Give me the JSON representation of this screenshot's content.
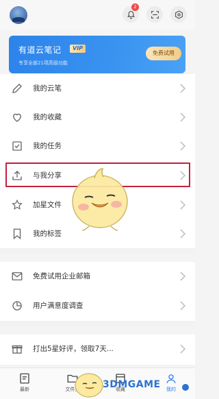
{
  "header": {
    "notification_count": "2",
    "icons": [
      "bell-icon",
      "scan-icon",
      "settings-icon"
    ]
  },
  "vip": {
    "title": "有道云笔记",
    "tag": "VIP",
    "subtitle": "专享全部21项高级功能",
    "button": "免费试用"
  },
  "menu": {
    "group1": [
      {
        "label": "我的云笔",
        "icon": "pencil-icon"
      },
      {
        "label": "我的收藏",
        "icon": "heart-icon"
      },
      {
        "label": "我的任务",
        "icon": "checkbox-icon"
      },
      {
        "label": "与我分享",
        "icon": "share-upload-icon"
      },
      {
        "label": "加星文件",
        "icon": "star-icon"
      },
      {
        "label": "我的标签",
        "icon": "bookmark-icon"
      }
    ],
    "group2": [
      {
        "label": "免费试用企业邮箱",
        "icon": "mail-icon"
      },
      {
        "label": "用户满意度调查",
        "icon": "pie-chart-icon"
      }
    ],
    "group3": [
      {
        "label": "打出5星好评，领取7天...",
        "icon": "gift-icon"
      }
    ]
  },
  "tabbar": {
    "tabs": [
      {
        "label": "最新",
        "icon": "doc-list-icon"
      },
      {
        "label": "文件夹",
        "icon": "folder-icon"
      },
      {
        "label": "收藏",
        "icon": "bookmark-tab-icon"
      },
      {
        "label": "我的",
        "icon": "profile-icon"
      }
    ]
  },
  "watermark": "3DMGAME",
  "colors": {
    "accent": "#2c83ea",
    "highlight_border": "#c2213c",
    "badge": "#f04848"
  }
}
